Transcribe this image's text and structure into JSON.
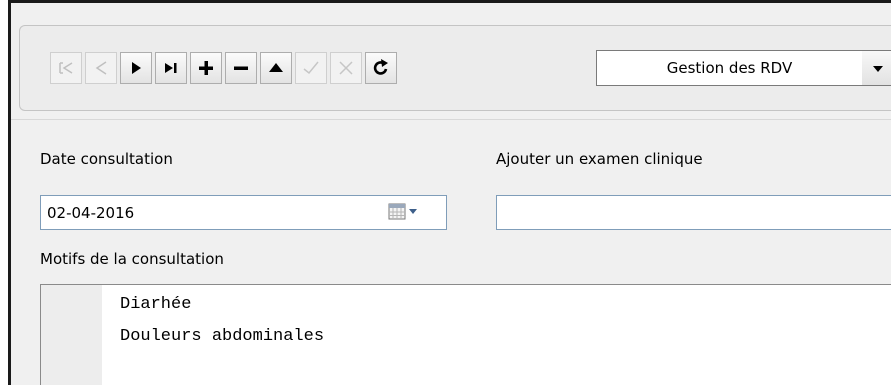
{
  "toolbar": {
    "buttons": [
      {
        "name": "first-record-button",
        "icon": "first-record-icon",
        "enabled": false
      },
      {
        "name": "previous-record-button",
        "icon": "previous-record-icon",
        "enabled": false
      },
      {
        "name": "next-record-button",
        "icon": "next-record-icon",
        "enabled": true
      },
      {
        "name": "last-record-button",
        "icon": "last-record-icon",
        "enabled": true
      },
      {
        "name": "add-record-button",
        "icon": "plus-icon",
        "enabled": true
      },
      {
        "name": "delete-record-button",
        "icon": "minus-icon",
        "enabled": true
      },
      {
        "name": "edit-record-button",
        "icon": "triangle-up-icon",
        "enabled": true
      },
      {
        "name": "save-record-button",
        "icon": "checkmark-icon",
        "enabled": false
      },
      {
        "name": "cancel-edit-button",
        "icon": "cross-icon",
        "enabled": false
      },
      {
        "name": "refresh-button",
        "icon": "refresh-icon",
        "enabled": true
      }
    ],
    "gestion": {
      "selected": "Gestion des RDV"
    }
  },
  "form": {
    "date_label": "Date consultation",
    "date_value": "02-04-2016",
    "exam_label": "Ajouter un examen clinique",
    "exam_value": "",
    "motifs_label": "Motifs de la consultation",
    "motifs_lines": [
      "Diarhée",
      "Douleurs abdominales"
    ]
  },
  "colors": {
    "field_border": "#7f9db9",
    "window_bg": "#f0f0f0"
  }
}
